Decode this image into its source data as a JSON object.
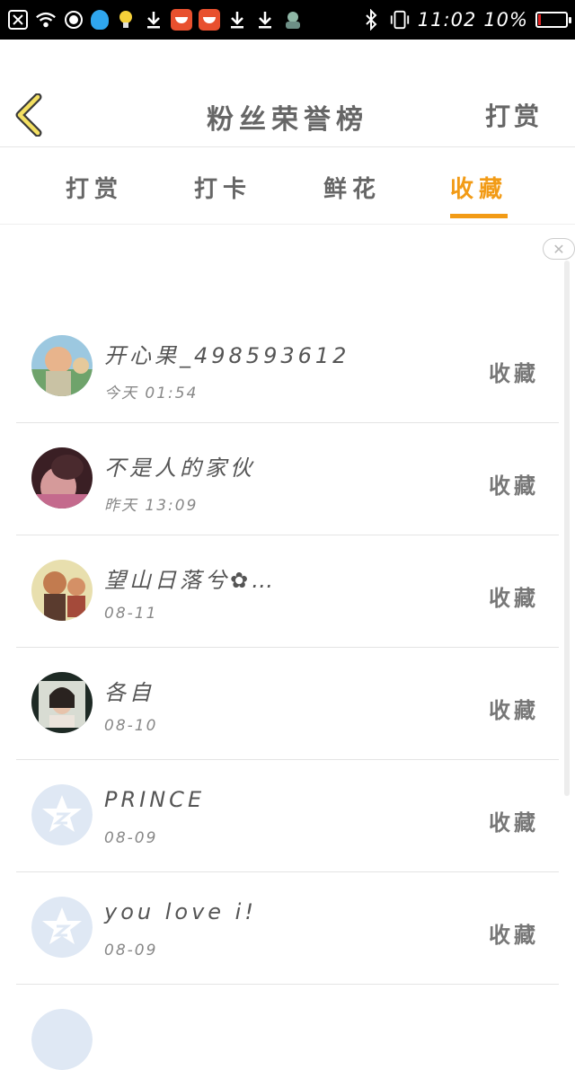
{
  "status_bar": {
    "time": "11:02",
    "battery": "10%",
    "battery_level": 0.1
  },
  "header": {
    "title": "粉丝荣誉榜",
    "right_action": "打赏"
  },
  "tabs": [
    {
      "label": "打赏",
      "active": false
    },
    {
      "label": "打卡",
      "active": false
    },
    {
      "label": "鲜花",
      "active": false
    },
    {
      "label": "收藏",
      "active": true
    }
  ],
  "list": {
    "items": [
      {
        "name": "开心果_498593612",
        "time": "今天 01:54",
        "badge": "收藏",
        "avatar": "photo-child"
      },
      {
        "name": "不是人的家伙",
        "time": "昨天 13:09",
        "badge": "收藏",
        "avatar": "photo-woman"
      },
      {
        "name": "望山日落兮✿…",
        "time": "08-11",
        "badge": "收藏",
        "avatar": "photo-cartoon"
      },
      {
        "name": "各自",
        "time": "08-10",
        "badge": "收藏",
        "avatar": "photo-portrait"
      },
      {
        "name": "PRINCE",
        "time": "08-09",
        "badge": "收藏",
        "avatar": "default-star-icon"
      },
      {
        "name": "you love i!",
        "time": "08-09",
        "badge": "收藏",
        "avatar": "default-star-icon"
      }
    ]
  },
  "colors": {
    "accent": "#f29b16",
    "text": "#555555",
    "default_avatar": "#dfe8f4"
  }
}
